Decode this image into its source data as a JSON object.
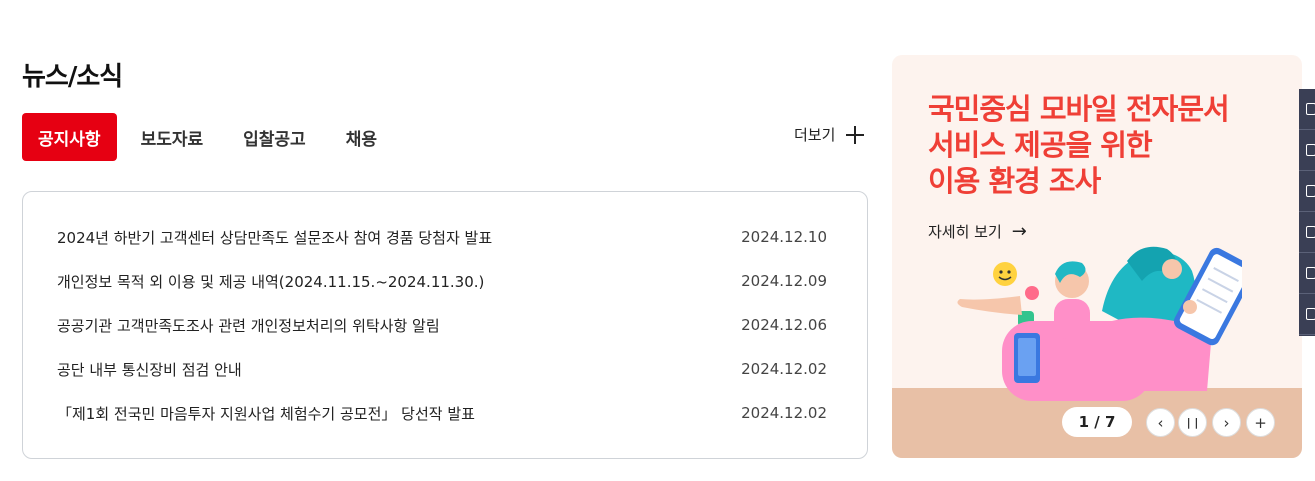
{
  "news": {
    "title": "뉴스/소식",
    "tabs": [
      {
        "label": "공지사항",
        "active": true
      },
      {
        "label": "보도자료",
        "active": false
      },
      {
        "label": "입찰공고",
        "active": false
      },
      {
        "label": "채용",
        "active": false
      }
    ],
    "more_label": "더보기",
    "items": [
      {
        "title": "2024년 하반기 고객센터 상담만족도 설문조사 참여 경품 당첨자 발표",
        "date": "2024.12.10"
      },
      {
        "title": "개인정보 목적 외 이용 및 제공 내역(2024.11.15.~2024.11.30.)",
        "date": "2024.12.09"
      },
      {
        "title": "공공기관 고객만족도조사 관련 개인정보처리의 위탁사항 알림",
        "date": "2024.12.06"
      },
      {
        "title": "공단 내부 통신장비 점검 안내",
        "date": "2024.12.02"
      },
      {
        "title": "「제1회 전국민 마음투자 지원사업 체험수기 공모전」 당선작 발표",
        "date": "2024.12.02"
      }
    ]
  },
  "banner": {
    "headline": [
      "국민중심 모바일 전자문서",
      "서비스 제공을 위한",
      "이용 환경 조사"
    ],
    "link_label": "자세히 보기",
    "counter": "1 / 7",
    "accent_color": "#ef3f36",
    "background_color": "#fdf3ee"
  },
  "theme": {
    "primary": "#e60012"
  }
}
